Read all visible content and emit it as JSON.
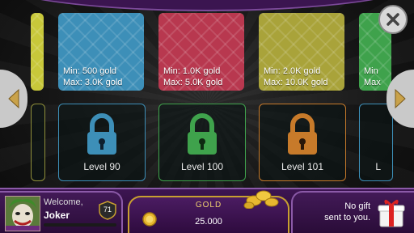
{
  "rooms": [
    {
      "min": "",
      "max": "",
      "color": "#c8c83a"
    },
    {
      "min": "Min: 500 gold",
      "max": "Max: 3.0K gold",
      "color": "#3d8fb8"
    },
    {
      "min": "Min: 1.0K gold",
      "max": "Max: 5.0K gold",
      "color": "#b8384f"
    },
    {
      "min": "Min: 2.0K gold",
      "max": "Max: 10.0K gold",
      "color": "#a9a33a"
    },
    {
      "min": "Min",
      "max": "Max",
      "color": "#3fa24c"
    }
  ],
  "locked_rooms": [
    {
      "level": "Level 90",
      "color": "#3d8fb8"
    },
    {
      "level": "Level 100",
      "color": "#3fa24c"
    },
    {
      "level": "Level 101",
      "color": "#c77a2a"
    },
    {
      "level": "L",
      "color": "#3d8fb8"
    }
  ],
  "profile": {
    "welcome": "Welcome,",
    "username": "Joker",
    "level": "71"
  },
  "gold": {
    "title": "GOLD",
    "amount": "25.000"
  },
  "gift": {
    "line1": "No gift",
    "line2": "sent to you."
  },
  "icons": {
    "left": "arrow-left-icon",
    "right": "arrow-right-icon",
    "close": "close-icon",
    "lock": "padlock-icon",
    "coin": "gold-coin-icon",
    "gift": "gift-box-icon"
  }
}
